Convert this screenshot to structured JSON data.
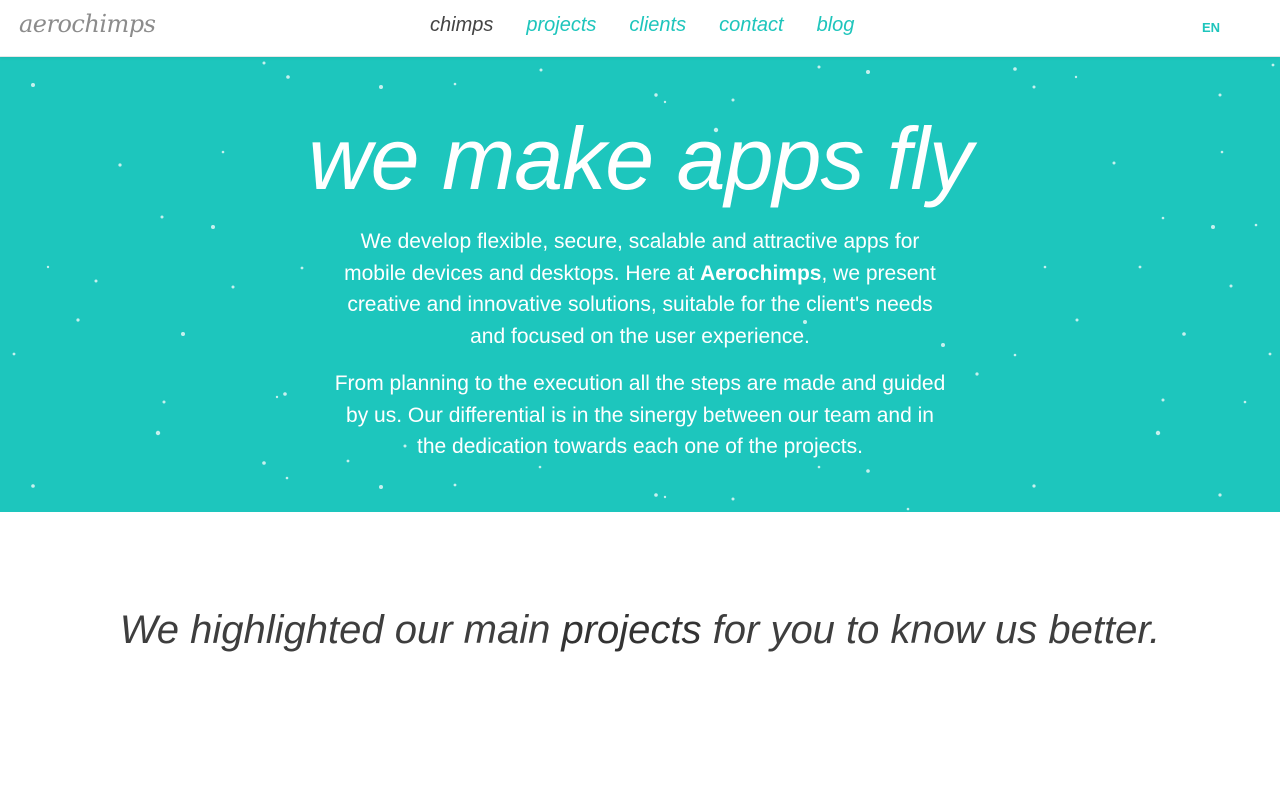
{
  "brand": {
    "logo_text": "aerochimps"
  },
  "nav": {
    "items": [
      {
        "label": "chimps",
        "active": true
      },
      {
        "label": "projects",
        "active": false
      },
      {
        "label": "clients",
        "active": false
      },
      {
        "label": "contact",
        "active": false
      },
      {
        "label": "blog",
        "active": false
      }
    ],
    "language": "EN"
  },
  "hero": {
    "title": "we make apps fly",
    "p1_before": "We develop flexible, secure, scalable and attractive apps for mobile devices and desktops. Here at ",
    "p1_brand": "Aerochimps",
    "p1_after": ", we present creative and innovative solutions, suitable for the client's needs and focused on the user experience.",
    "p2": "From planning to the execution all the steps are made and guided by us. Our differential is in the sinergy between our team and in the dedication towards each one of the projects."
  },
  "highlight": {
    "before": "We highlighted our main ",
    "emphasis": "projects",
    "after": " for you to know us better."
  },
  "colors": {
    "accent": "#1ec5bc",
    "hero_bg": "#1dc6bd",
    "text_dark": "#3e3e3e",
    "logo": "#8c8c8c"
  }
}
